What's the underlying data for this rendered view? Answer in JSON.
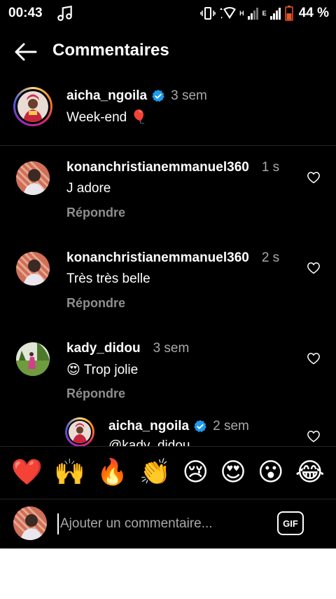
{
  "status_bar": {
    "time": "00:43",
    "battery": "44 %",
    "network_h": "H",
    "network_e": "E"
  },
  "header": {
    "title": "Commentaires",
    "back_icon": "arrow-left-icon"
  },
  "caption": {
    "username": "aicha_ngoila",
    "verified": true,
    "time": "3 sem",
    "text": "Week-end 🎈"
  },
  "comments": [
    {
      "username": "konanchristianemmanuel360",
      "time": "1 s",
      "text": "J adore",
      "reply": "Répondre"
    },
    {
      "username": "konanchristianemmanuel360",
      "time": "2 s",
      "text": "Très très belle",
      "reply": "Répondre"
    },
    {
      "username": "kady_didou",
      "time": "3 sem",
      "text": "😍 Trop jolie",
      "reply": "Répondre"
    }
  ],
  "nested_reply": {
    "username": "aicha_ngoila",
    "verified": true,
    "time": "2 sem",
    "text": "@kady_didou"
  },
  "reactions": [
    "❤️",
    "🙌",
    "🔥",
    "👏",
    "😢",
    "😍",
    "😮",
    "😂"
  ],
  "composer": {
    "placeholder": "Ajouter un commentaire...",
    "gif_label": "GIF"
  },
  "colors": {
    "background": "#000000",
    "text": "#ffffff",
    "muted": "#a8a8a8",
    "verified": "#1d9bf0"
  }
}
